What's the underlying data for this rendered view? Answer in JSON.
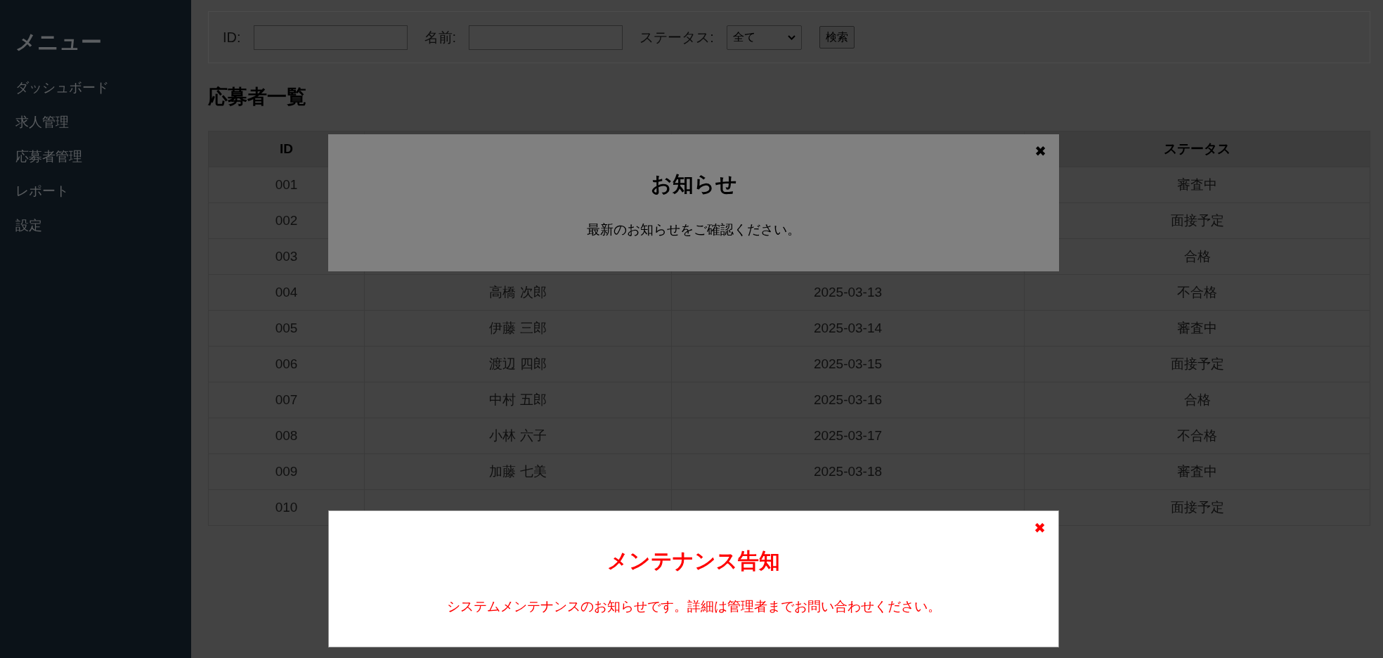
{
  "sidebar": {
    "title": "メニュー",
    "items": [
      {
        "label": "ダッシュボード"
      },
      {
        "label": "求人管理"
      },
      {
        "label": "応募者管理"
      },
      {
        "label": "レポート"
      },
      {
        "label": "設定"
      }
    ]
  },
  "filters": {
    "id_label": "ID:",
    "name_label": "名前:",
    "status_label": "ステータス:",
    "status_value": "全て",
    "search_button": "検索"
  },
  "heading": "応募者一覧",
  "table": {
    "columns": [
      "ID",
      null,
      null,
      "ステータス"
    ],
    "rows": [
      [
        "001",
        null,
        null,
        "審査中"
      ],
      [
        "002",
        null,
        null,
        "面接予定"
      ],
      [
        "003",
        null,
        null,
        "合格"
      ],
      [
        "004",
        "高橋 次郎",
        "2025-03-13",
        "不合格"
      ],
      [
        "005",
        "伊藤 三郎",
        "2025-03-14",
        "審査中"
      ],
      [
        "006",
        "渡辺 四郎",
        "2025-03-15",
        "面接予定"
      ],
      [
        "007",
        "中村 五郎",
        "2025-03-16",
        "合格"
      ],
      [
        "008",
        "小林 六子",
        "2025-03-17",
        "不合格"
      ],
      [
        "009",
        "加藤 七美",
        "2025-03-18",
        "審査中"
      ],
      [
        "010",
        null,
        null,
        "面接予定"
      ]
    ]
  },
  "modals": [
    {
      "kind": "notice",
      "title": "お知らせ",
      "message": "最新のお知らせをご確認ください。",
      "close": "✖"
    },
    {
      "kind": "warning",
      "title": "メンテナンス告知",
      "message": "システムメンテナンスのお知らせです。詳細は管理者までお問い合わせください。",
      "close": "✖"
    }
  ]
}
